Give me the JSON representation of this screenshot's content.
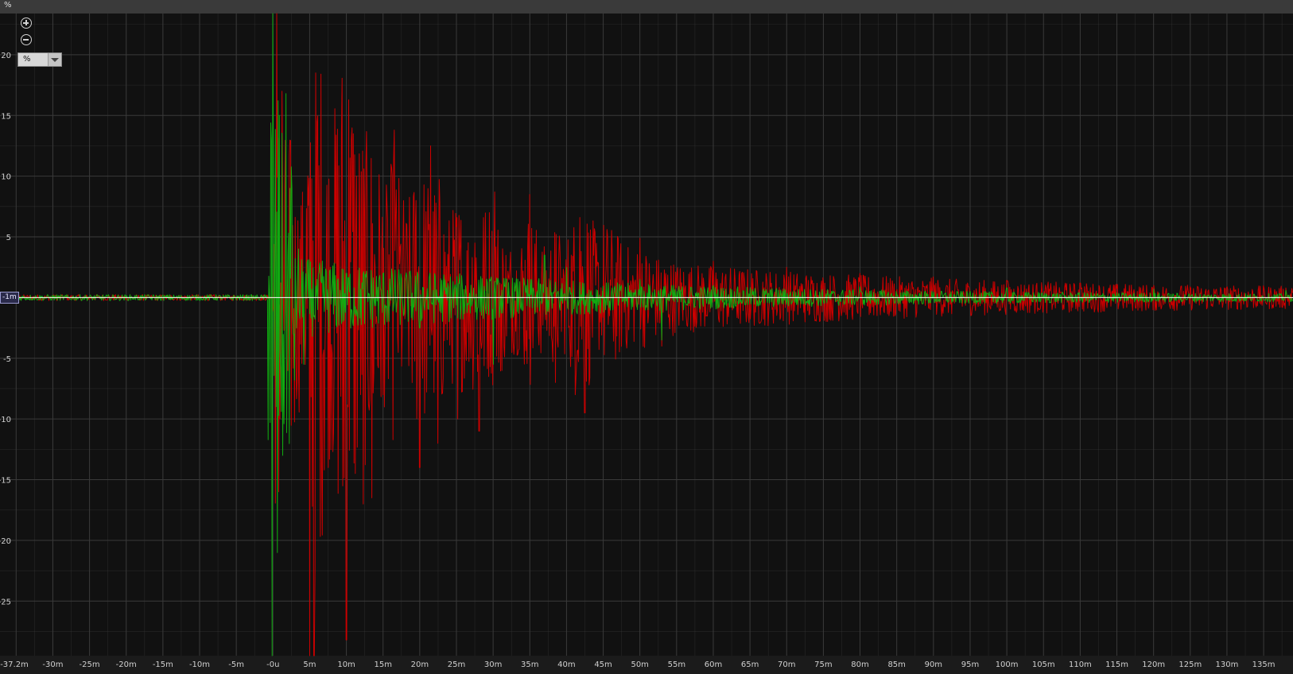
{
  "header": {
    "unit_label": "%"
  },
  "controls": {
    "zoom_in_icon": "zoom-in-icon",
    "zoom_out_icon": "zoom-out-icon",
    "unit_select_value": "%"
  },
  "cursor": {
    "y_readout": "-1m"
  },
  "colors": {
    "background": "#111111",
    "grid": "#3a3a3a",
    "axis_text": "#d0d0d0",
    "left_channel": "#cc0000",
    "right_channel": "#11aa11",
    "cursor_line": "#ffffff"
  },
  "chart_data": {
    "type": "line",
    "title": "",
    "xlabel": "",
    "ylabel": "%",
    "xlim": [
      -37.2,
      139
    ],
    "ylim": [
      -29.5,
      23.4
    ],
    "grid": true,
    "x_tick_labels": [
      "-37.2m",
      "-30m",
      "-25m",
      "-20m",
      "-15m",
      "-10m",
      "-5m",
      "-0u",
      "5m",
      "10m",
      "15m",
      "20m",
      "25m",
      "30m",
      "35m",
      "40m",
      "45m",
      "50m",
      "55m",
      "60m",
      "65m",
      "70m",
      "75m",
      "80m",
      "85m",
      "90m",
      "95m",
      "100m",
      "105m",
      "110m",
      "115m",
      "120m",
      "125m",
      "130m",
      "135m"
    ],
    "x_tick_values": [
      -37.2,
      -30,
      -25,
      -20,
      -15,
      -10,
      -5,
      0,
      5,
      10,
      15,
      20,
      25,
      30,
      35,
      40,
      45,
      50,
      55,
      60,
      65,
      70,
      75,
      80,
      85,
      90,
      95,
      100,
      105,
      110,
      115,
      120,
      125,
      130,
      135
    ],
    "y_tick_labels": [
      "20",
      "15",
      "10",
      "5",
      "-5",
      "-10",
      "-15",
      "-20",
      "-25"
    ],
    "y_tick_values": [
      20,
      15,
      10,
      5,
      -5,
      -10,
      -15,
      -20,
      -25
    ],
    "x_unit": "ms",
    "y_unit": "%",
    "series": [
      {
        "color": "#cc0000",
        "peaks": [
          {
            "x": 0.5,
            "y": 23.4
          },
          {
            "x": 0.8,
            "y": -16
          },
          {
            "x": 1.2,
            "y": 17
          },
          {
            "x": 2.0,
            "y": -6
          },
          {
            "x": 3.5,
            "y": -6
          },
          {
            "x": 5.0,
            "y": -29.5
          },
          {
            "x": 5.8,
            "y": 18.5
          },
          {
            "x": 5.6,
            "y": -29.5
          },
          {
            "x": 7.5,
            "y": -14
          },
          {
            "x": 9.3,
            "y": 13.5
          },
          {
            "x": 9.5,
            "y": -15.5
          },
          {
            "x": 10.0,
            "y": -28.2
          },
          {
            "x": 10.5,
            "y": 11.5
          },
          {
            "x": 12.3,
            "y": -17
          },
          {
            "x": 13.5,
            "y": -16.5
          },
          {
            "x": 15.0,
            "y": -8
          },
          {
            "x": 16.5,
            "y": 13.8
          },
          {
            "x": 19.5,
            "y": 8
          },
          {
            "x": 20.0,
            "y": -14
          },
          {
            "x": 21.5,
            "y": 12.5
          },
          {
            "x": 22.5,
            "y": -12
          },
          {
            "x": 25.2,
            "y": -10
          },
          {
            "x": 27.5,
            "y": 4.5
          },
          {
            "x": 28.1,
            "y": -11
          },
          {
            "x": 29.5,
            "y": 7
          },
          {
            "x": 30.2,
            "y": 8.7
          },
          {
            "x": 31.2,
            "y": -6
          },
          {
            "x": 35.0,
            "y": 8.5
          },
          {
            "x": 38.5,
            "y": -7
          },
          {
            "x": 41.2,
            "y": -8
          },
          {
            "x": 41.8,
            "y": 6.6
          },
          {
            "x": 42.5,
            "y": -9.5
          },
          {
            "x": 50.0,
            "y": 4.9
          },
          {
            "x": 53.0,
            "y": -4
          },
          {
            "x": 60.0,
            "y": 3
          },
          {
            "x": 70.0,
            "y": 2.5
          },
          {
            "x": 80.0,
            "y": 2
          },
          {
            "x": 90.0,
            "y": 1.7
          },
          {
            "x": 100.0,
            "y": 1.4
          },
          {
            "x": 110.0,
            "y": 1.2
          },
          {
            "x": 120.0,
            "y": 1.0
          },
          {
            "x": 130.0,
            "y": 0.9
          },
          {
            "x": 138.0,
            "y": 0.8
          }
        ]
      },
      {
        "color": "#11aa11",
        "peaks": [
          {
            "x": -0.1,
            "y": -29.5
          },
          {
            "x": 0.0,
            "y": 23.4
          },
          {
            "x": 0.6,
            "y": -21
          },
          {
            "x": 0.9,
            "y": 15
          },
          {
            "x": 1.3,
            "y": -13
          },
          {
            "x": 1.8,
            "y": 16.8
          },
          {
            "x": 2.3,
            "y": 9
          },
          {
            "x": 2.8,
            "y": -3
          },
          {
            "x": 3.5,
            "y": 4
          },
          {
            "x": 4.2,
            "y": -5.5
          },
          {
            "x": 6.0,
            "y": 1.5
          },
          {
            "x": 10.0,
            "y": 2
          },
          {
            "x": 20.0,
            "y": -2.5
          },
          {
            "x": 30.0,
            "y": -5.5
          },
          {
            "x": 37.0,
            "y": 3.5
          },
          {
            "x": 40.0,
            "y": 2.5
          },
          {
            "x": 50.0,
            "y": 1.5
          },
          {
            "x": 53.0,
            "y": -3.5
          },
          {
            "x": 60.0,
            "y": 1.0
          },
          {
            "x": 80.0,
            "y": 0.9
          },
          {
            "x": 100.0,
            "y": 0.8
          },
          {
            "x": 120.0,
            "y": 0.7
          },
          {
            "x": 138.0,
            "y": 0.6
          }
        ]
      }
    ]
  }
}
